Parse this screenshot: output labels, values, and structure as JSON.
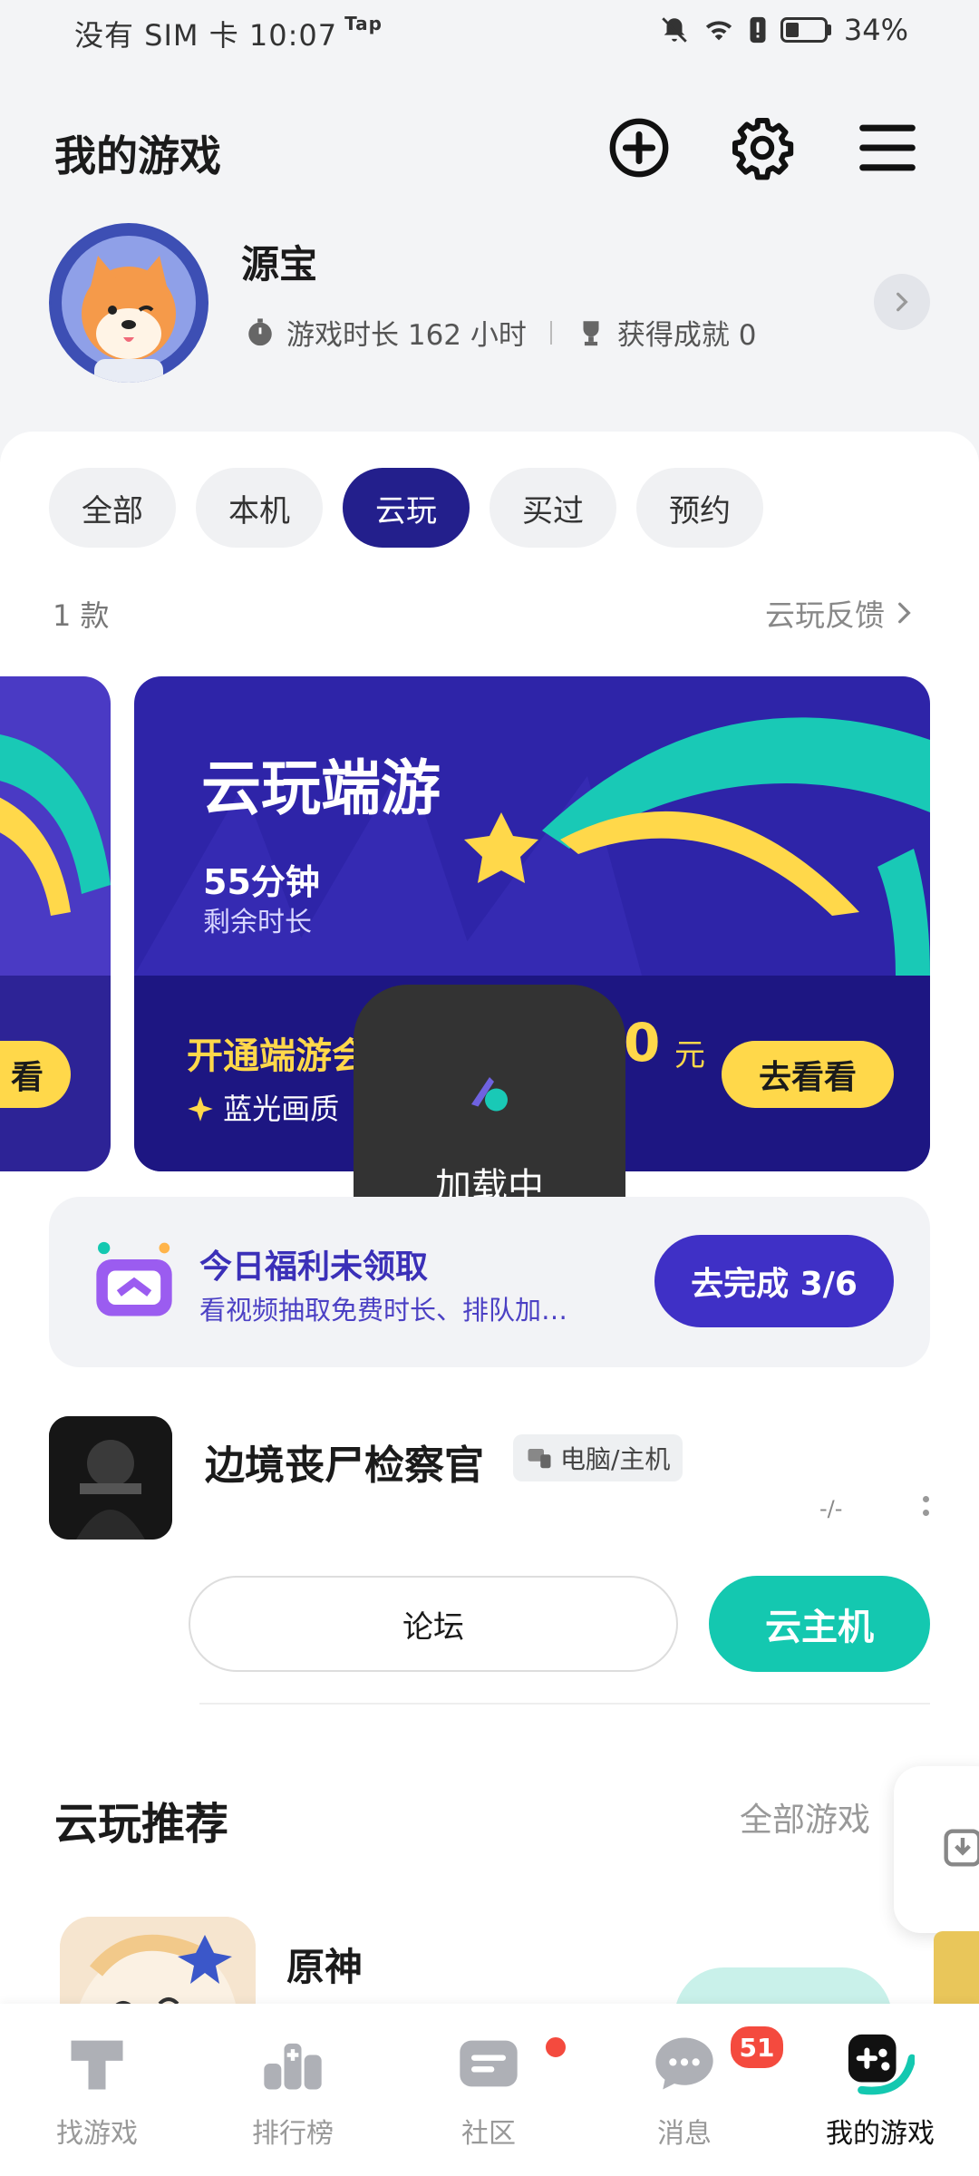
{
  "status_bar": {
    "carrier": "没有 SIM 卡 10:07",
    "tap_label": "Tap",
    "battery": "34%"
  },
  "header": {
    "title": "我的游戏"
  },
  "profile": {
    "name": "源宝",
    "play_time_label": "游戏时长 162 小时",
    "achievements_label": "获得成就 0"
  },
  "filters": {
    "items": [
      "全部",
      "本机",
      "云玩",
      "买过",
      "预约"
    ],
    "active": "云玩"
  },
  "list_meta": {
    "count": "1 款",
    "feedback": "云玩反馈"
  },
  "cloud_card": {
    "title": "云玩端游",
    "minutes": "55分钟",
    "minutes_label": "剩余时长",
    "promo": "开通端游会",
    "price": "0",
    "price_unit": "元",
    "feature": "蓝光画质",
    "button": "去看看",
    "left_button": "看"
  },
  "loading": {
    "text": "加载中"
  },
  "welfare": {
    "title": "今日福利未领取",
    "subtitle": "看视频抽取免费时长、排队加…",
    "button": "去完成 3/6"
  },
  "game": {
    "name": "边境丧尸检察官",
    "tag": "电脑/主机",
    "sub": "-/-",
    "forum_button": "论坛",
    "cloud_button": "云主机"
  },
  "recommend": {
    "title": "云玩推荐",
    "all_link": "全部游戏",
    "game_name": "原神"
  },
  "nav": {
    "items": [
      {
        "label": "找游戏"
      },
      {
        "label": "排行榜"
      },
      {
        "label": "社区"
      },
      {
        "label": "消息",
        "badge": "51"
      },
      {
        "label": "我的游戏"
      }
    ]
  },
  "colors": {
    "accent": "#231f8c",
    "cloud_btn": "#14c8b0",
    "gold": "#ffd84a",
    "welfare_btn": "#3f30c6"
  }
}
